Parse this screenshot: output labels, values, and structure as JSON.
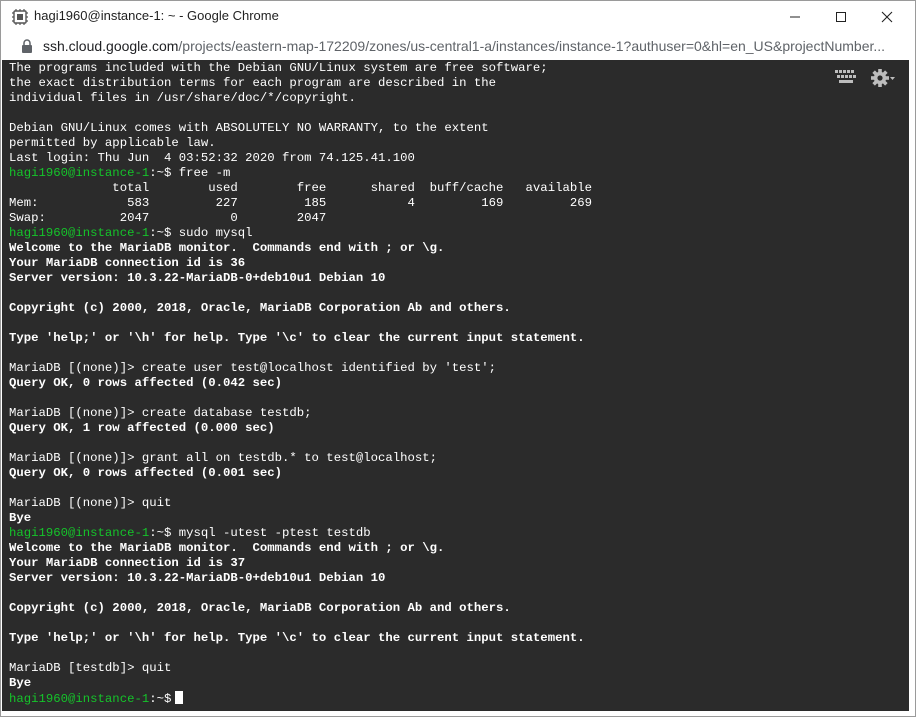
{
  "window": {
    "title": "hagi1960@instance-1: ~ - Google Chrome"
  },
  "address": {
    "host": "ssh.cloud.google.com",
    "path": "/projects/eastern-map-172209/zones/us-central1-a/instances/instance-1?authuser=0&hl=en_US&projectNumber..."
  },
  "terminal": {
    "prompt": "hagi1960@instance-1",
    "lines": [
      {
        "text": "The programs included with the Debian GNU/Linux system are free software;"
      },
      {
        "text": "the exact distribution terms for each program are described in the"
      },
      {
        "text": "individual files in /usr/share/doc/*/copyright."
      },
      {
        "text": ""
      },
      {
        "text": "Debian GNU/Linux comes with ABSOLUTELY NO WARRANTY, to the extent"
      },
      {
        "text": "permitted by applicable law."
      },
      {
        "text": "Last login: Thu Jun  4 03:52:32 2020 from 74.125.41.100"
      },
      {
        "prompt": true,
        "text": ":~$ free -m"
      },
      {
        "text": "              total        used        free      shared  buff/cache   available"
      },
      {
        "text": "Mem:            583         227         185           4         169         269"
      },
      {
        "text": "Swap:          2047           0        2047"
      },
      {
        "prompt": true,
        "text": ":~$ sudo mysql"
      },
      {
        "bold": true,
        "text": "Welcome to the MariaDB monitor.  Commands end with ; or \\g."
      },
      {
        "bold": true,
        "text": "Your MariaDB connection id is 36"
      },
      {
        "bold": true,
        "text": "Server version: 10.3.22-MariaDB-0+deb10u1 Debian 10"
      },
      {
        "text": ""
      },
      {
        "bold": true,
        "text": "Copyright (c) 2000, 2018, Oracle, MariaDB Corporation Ab and others."
      },
      {
        "text": ""
      },
      {
        "bold": true,
        "text": "Type 'help;' or '\\h' for help. Type '\\c' to clear the current input statement."
      },
      {
        "text": ""
      },
      {
        "text": "MariaDB [(none)]> create user test@localhost identified by 'test';"
      },
      {
        "bold": true,
        "text": "Query OK, 0 rows affected (0.042 sec)"
      },
      {
        "text": ""
      },
      {
        "text": "MariaDB [(none)]> create database testdb;"
      },
      {
        "bold": true,
        "text": "Query OK, 1 row affected (0.000 sec)"
      },
      {
        "text": ""
      },
      {
        "text": "MariaDB [(none)]> grant all on testdb.* to test@localhost;"
      },
      {
        "bold": true,
        "text": "Query OK, 0 rows affected (0.001 sec)"
      },
      {
        "text": ""
      },
      {
        "text": "MariaDB [(none)]> quit"
      },
      {
        "bold": true,
        "text": "Bye"
      },
      {
        "prompt": true,
        "text": ":~$ mysql -utest -ptest testdb"
      },
      {
        "bold": true,
        "text": "Welcome to the MariaDB monitor.  Commands end with ; or \\g."
      },
      {
        "bold": true,
        "text": "Your MariaDB connection id is 37"
      },
      {
        "bold": true,
        "text": "Server version: 10.3.22-MariaDB-0+deb10u1 Debian 10"
      },
      {
        "text": ""
      },
      {
        "bold": true,
        "text": "Copyright (c) 2000, 2018, Oracle, MariaDB Corporation Ab and others."
      },
      {
        "text": ""
      },
      {
        "bold": true,
        "text": "Type 'help;' or '\\h' for help. Type '\\c' to clear the current input statement."
      },
      {
        "text": ""
      },
      {
        "text": "MariaDB [testdb]> quit"
      },
      {
        "bold": true,
        "text": "Bye"
      },
      {
        "prompt": true,
        "text": ":~$",
        "cursor": true
      }
    ]
  },
  "icons": {
    "app": "ssh-terminal-icon",
    "lock": "lock-icon",
    "minimize": "minimize-icon",
    "maximize": "maximize-icon",
    "close": "close-icon",
    "keyboard": "keyboard-icon",
    "settings": "gear-icon"
  },
  "colors": {
    "terminal_bg": "#2b2b2b",
    "terminal_fg": "#ffffff",
    "prompt": "#15c42a"
  }
}
